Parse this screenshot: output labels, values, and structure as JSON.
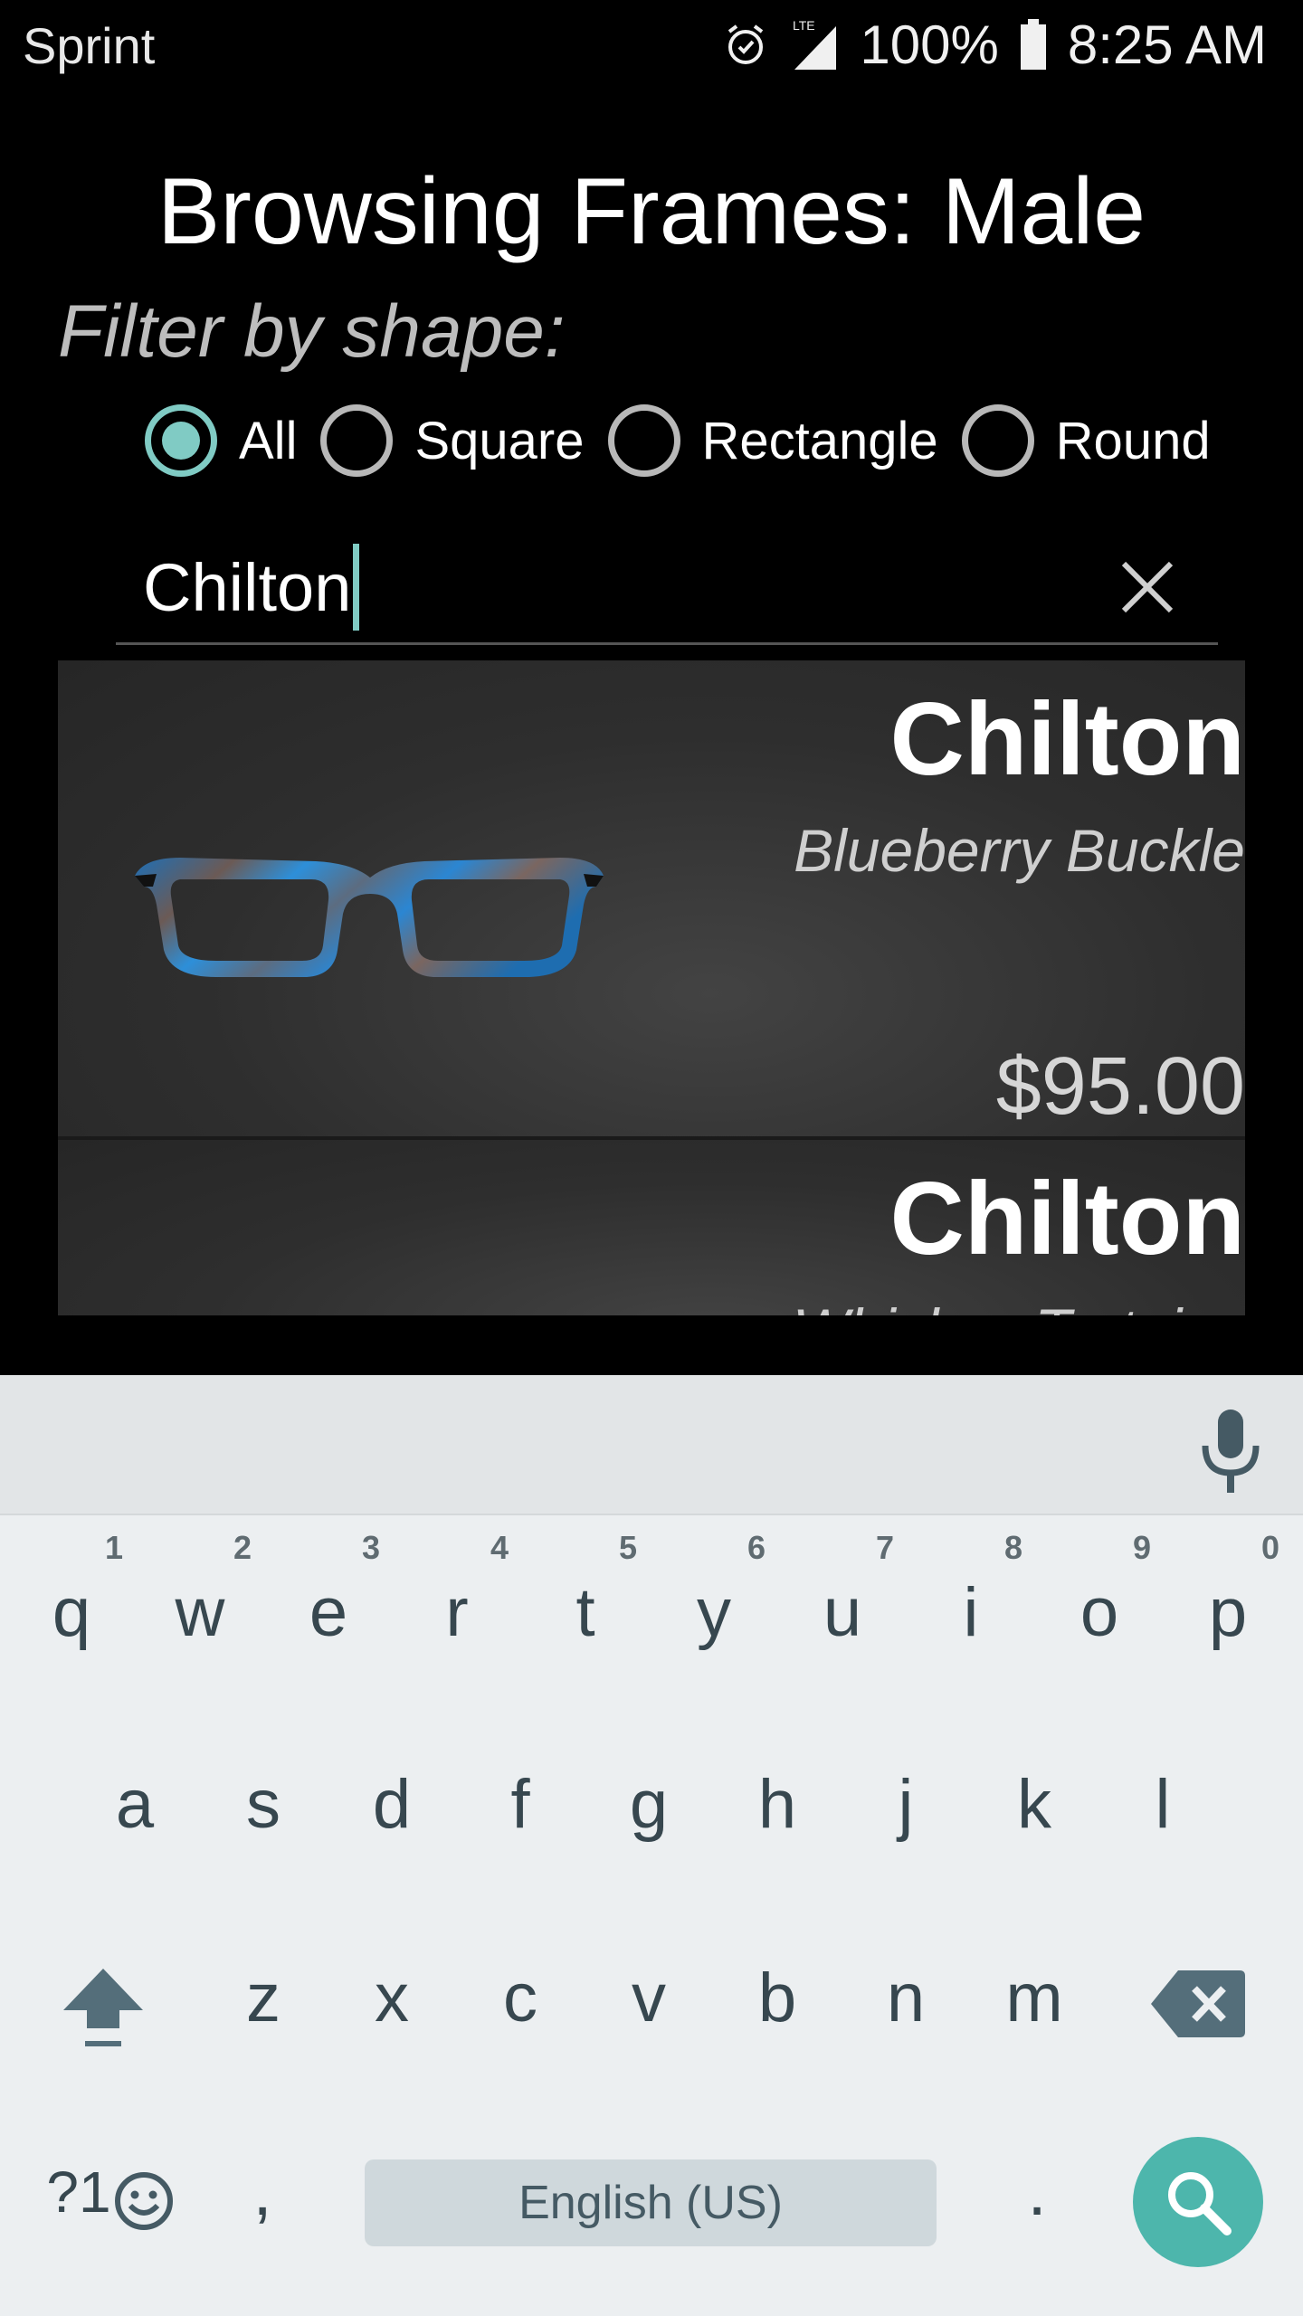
{
  "status_bar": {
    "carrier": "Sprint",
    "network": "LTE",
    "battery": "100%",
    "time": "8:25 AM",
    "icons": [
      "alarm-icon",
      "signal-icon",
      "battery-icon"
    ]
  },
  "header": {
    "title": "Browsing Frames: Male",
    "filter_label": "Filter by shape:"
  },
  "shape_filter": {
    "selected": "All",
    "options": [
      {
        "label": "All",
        "checked": true
      },
      {
        "label": "Square",
        "checked": false
      },
      {
        "label": "Rectangle",
        "checked": false
      },
      {
        "label": "Round",
        "checked": false
      }
    ]
  },
  "search": {
    "value": "Chilton",
    "clear_icon": "close-icon"
  },
  "results": [
    {
      "name": "Chilton",
      "color": "Blueberry Buckle",
      "price": "$95.00"
    },
    {
      "name": "Chilton",
      "color": "Whiskey Tortoise"
    }
  ],
  "keyboard": {
    "row1": [
      {
        "char": "q",
        "hint": "1"
      },
      {
        "char": "w",
        "hint": "2"
      },
      {
        "char": "e",
        "hint": "3"
      },
      {
        "char": "r",
        "hint": "4"
      },
      {
        "char": "t",
        "hint": "5"
      },
      {
        "char": "y",
        "hint": "6"
      },
      {
        "char": "u",
        "hint": "7"
      },
      {
        "char": "i",
        "hint": "8"
      },
      {
        "char": "o",
        "hint": "9"
      },
      {
        "char": "p",
        "hint": "0"
      }
    ],
    "row2": [
      "a",
      "s",
      "d",
      "f",
      "g",
      "h",
      "j",
      "k",
      "l"
    ],
    "row3": [
      "z",
      "x",
      "c",
      "v",
      "b",
      "n",
      "m"
    ],
    "symbols_key": "?1",
    "comma_key": ",",
    "period_key": ".",
    "spacebar_label": "English (US)",
    "accent_color": "#4db6ac"
  },
  "colors": {
    "accent": "#80cbc4",
    "background": "#000000",
    "card": "#2e2e2e"
  }
}
